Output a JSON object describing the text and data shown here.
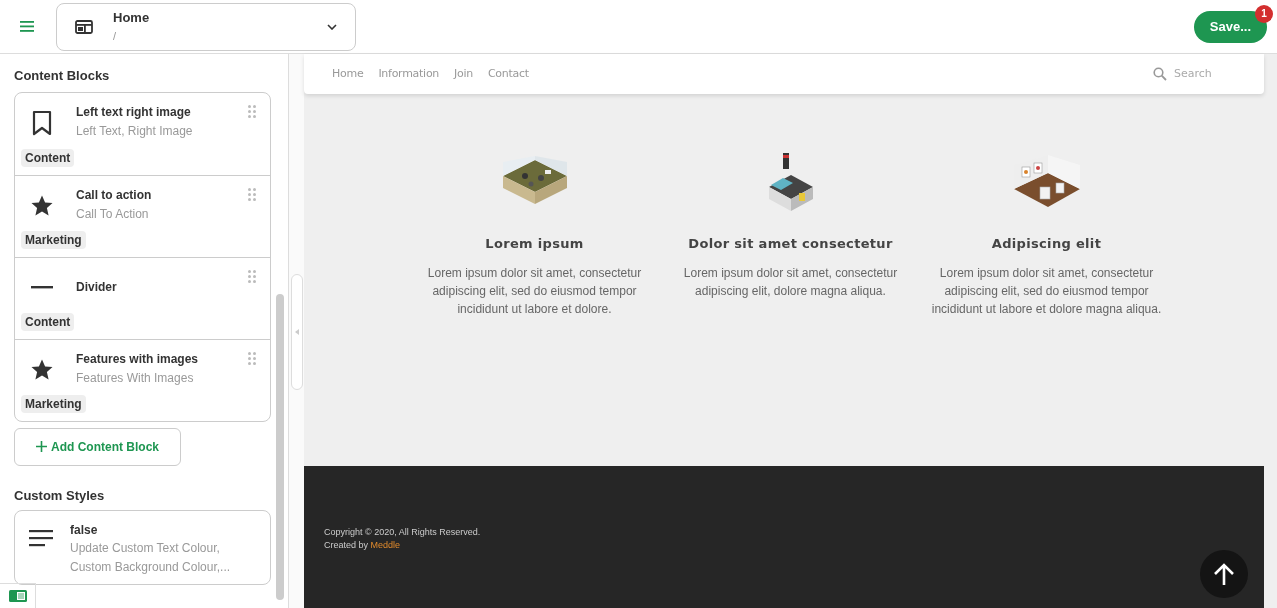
{
  "header": {
    "page_title": "Home",
    "page_path": "/",
    "save_label": "Save...",
    "save_badge": "1"
  },
  "sidebar": {
    "blocks_heading": "Content Blocks",
    "blocks": [
      {
        "kind": "bookmark",
        "title": "Left text right image",
        "subtitle": "Left Text, Right Image",
        "tag": "Content"
      },
      {
        "kind": "star",
        "title": "Call to action",
        "subtitle": "Call To Action",
        "tag": "Marketing"
      },
      {
        "kind": "divider",
        "title": "Divider",
        "tag": "Content"
      },
      {
        "kind": "star",
        "title": "Features with images",
        "subtitle": "Features With Images",
        "tag": "Marketing"
      }
    ],
    "add_block_label": "Add Content Block",
    "styles_heading": "Custom Styles",
    "style_card": {
      "title": "false",
      "lines": [
        "Update Custom Text Colour,",
        "Custom Background Colour,..."
      ]
    }
  },
  "preview": {
    "nav": [
      "Home",
      "Information",
      "Join",
      "Contact"
    ],
    "search_placeholder": "Search",
    "features": [
      {
        "kind": "office",
        "title": "Lorem ipsum",
        "text": "Lorem ipsum dolor sit amet, consectetur adipiscing elit, sed do eiusmod tempor incididunt ut labore et dolore."
      },
      {
        "kind": "factory",
        "title": "Dolor sit amet consectetur",
        "text": "Lorem ipsum dolor sit amet, consectetur adipiscing elit, dolore magna aliqua."
      },
      {
        "kind": "gallery",
        "title": "Adipiscing elit",
        "text": "Lorem ipsum dolor sit amet, consectetur adipiscing elit, sed do eiusmod tempor incididunt ut labore et dolore magna aliqua."
      }
    ],
    "footer": {
      "copyright": "Copyright © 2020, All Rights Reserved.",
      "created_by": "Created by",
      "link": "Meddle"
    }
  }
}
